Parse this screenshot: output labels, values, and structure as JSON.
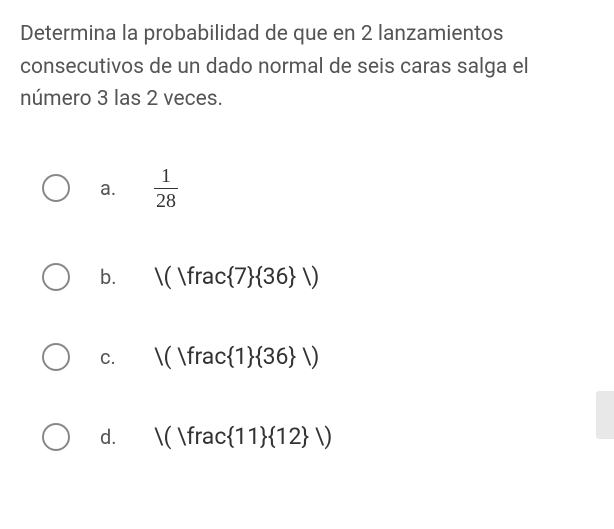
{
  "question": "Determina la probabilidad de que en 2 lanzamientos consecutivos de un dado normal de seis caras salga el número 3 las 2 veces.",
  "options": {
    "a": {
      "label": "a.",
      "fraction_num": "1",
      "fraction_den": "28"
    },
    "b": {
      "label": "b.",
      "text": "\\( \\frac{7}{36} \\)"
    },
    "c": {
      "label": "c.",
      "text": "\\( \\frac{1}{36} \\)"
    },
    "d": {
      "label": "d.",
      "text": "\\( \\frac{11}{12} \\)"
    }
  }
}
